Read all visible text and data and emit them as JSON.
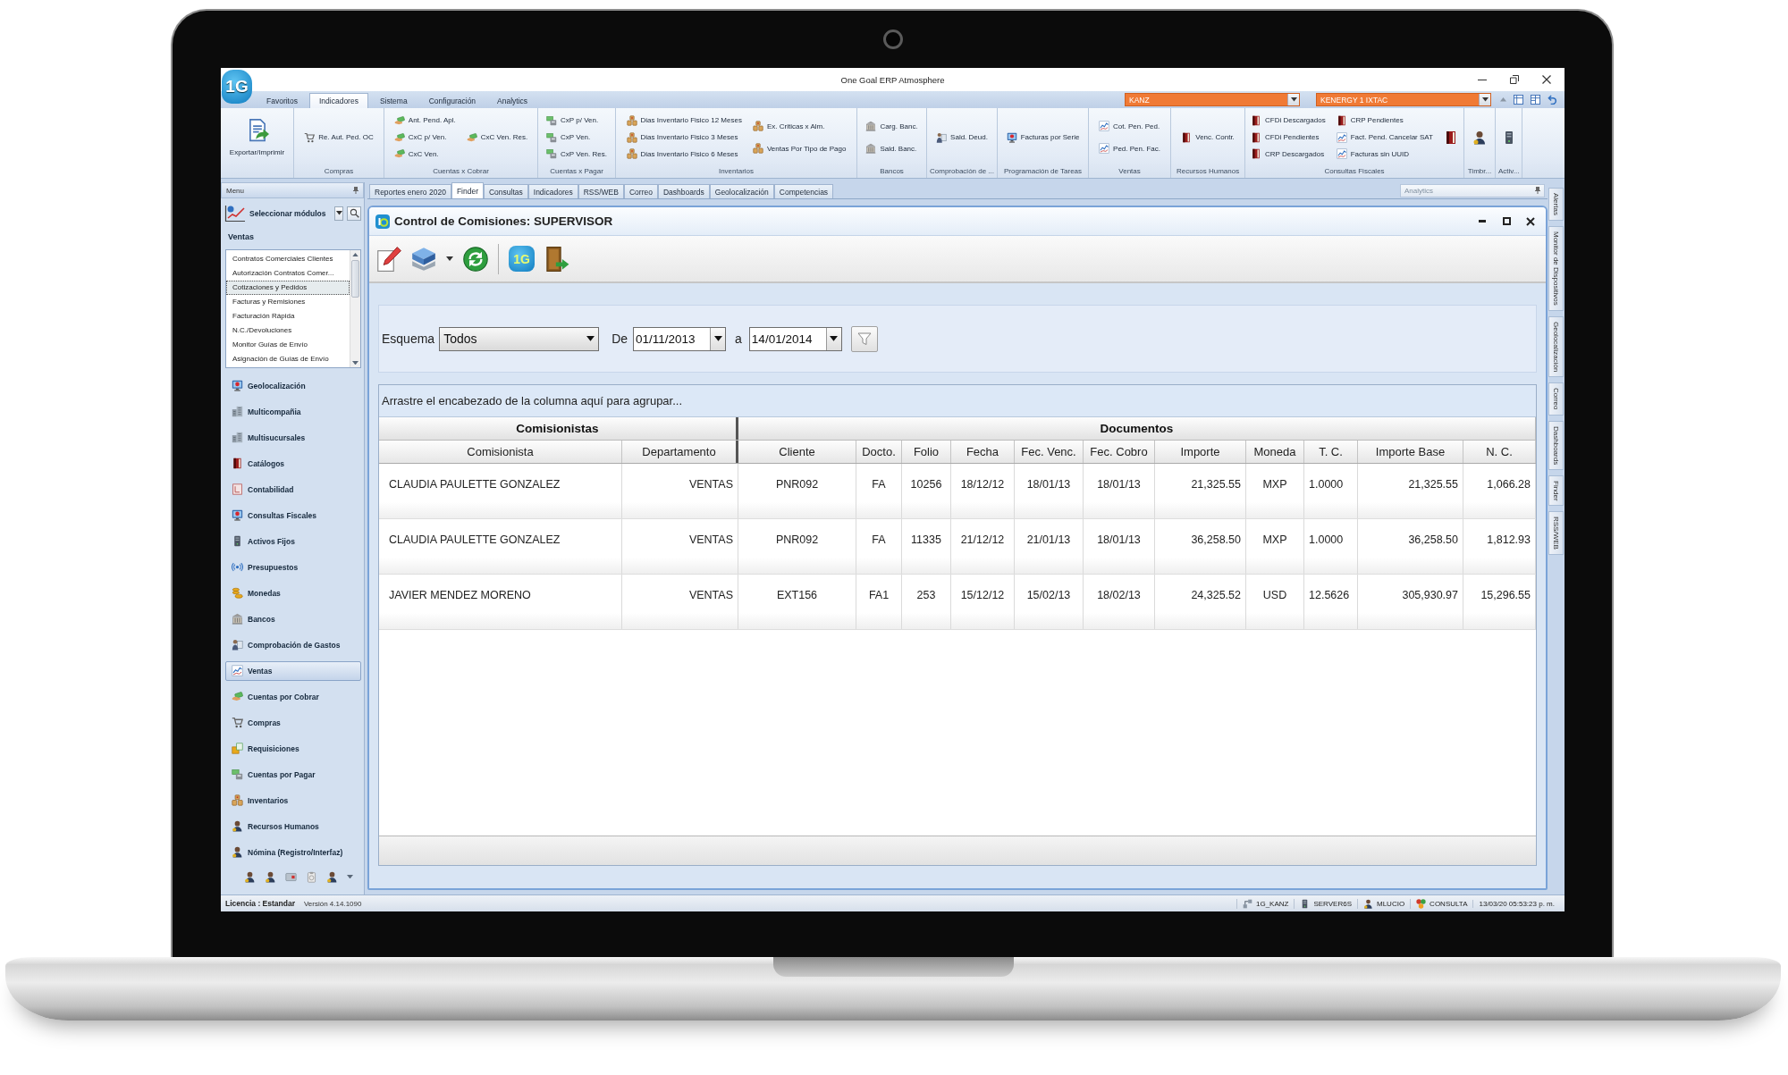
{
  "window": {
    "logo": "1G",
    "title": "One Goal ERP Atmosphere"
  },
  "ribbon": {
    "tabs": [
      {
        "label": "Favoritos",
        "selected": false
      },
      {
        "label": "Indicadores",
        "selected": true
      },
      {
        "label": "Sistema",
        "selected": false
      },
      {
        "label": "Configuración",
        "selected": false
      },
      {
        "label": "Analytics",
        "selected": false
      }
    ],
    "selectors": [
      {
        "value": "KANZ"
      },
      {
        "value": "KENERGY 1 IXTAC"
      }
    ],
    "groups": [
      {
        "columns": [
          [
            {
              "kind": "large",
              "label": "Exportar/Imprimir"
            }
          ]
        ]
      },
      {
        "label": "Compras",
        "columns": [
          [
            {
              "kind": "small",
              "label": "Re. Aut. Ped. OC"
            }
          ]
        ]
      },
      {
        "label": "Cuentas x Cobrar",
        "columns": [
          [
            {
              "kind": "small",
              "label": "Ant. Pend. Apl."
            },
            {
              "kind": "small",
              "label": "CxC p/ Ven."
            },
            {
              "kind": "small",
              "label": "CxC Ven."
            }
          ],
          [
            {
              "kind": "small",
              "label": "CxC Ven. Res."
            }
          ]
        ]
      },
      {
        "label": "Cuentas x Pagar",
        "columns": [
          [
            {
              "kind": "small",
              "label": "CxP p/ Ven."
            },
            {
              "kind": "small",
              "label": "CxP Ven."
            },
            {
              "kind": "small",
              "label": "CxP Ven. Res."
            }
          ]
        ]
      },
      {
        "label": "Inventarios",
        "columns": [
          [
            {
              "kind": "small",
              "label": "Dias Inventario Fisico 12 Meses"
            },
            {
              "kind": "small",
              "label": "Dias Inventario Fisico 3 Meses"
            },
            {
              "kind": "small",
              "label": "Dias Inventario Fisico 6 Meses"
            }
          ],
          [
            {
              "kind": "small",
              "label": "Ex. Criticas x Alm."
            },
            {
              "kind": "small",
              "label": "Ventas Por Tipo de Pago"
            }
          ]
        ]
      },
      {
        "label": "Bancos",
        "columns": [
          [
            {
              "kind": "small",
              "label": "Carg. Banc."
            },
            {
              "kind": "small",
              "label": "Sald. Banc."
            }
          ]
        ]
      },
      {
        "label": "Comprobación de ...",
        "columns": [
          [
            {
              "kind": "small",
              "label": "Sald. Deud."
            }
          ]
        ]
      },
      {
        "label": "Programación de Tareas",
        "columns": [
          [
            {
              "kind": "small",
              "label": "Facturas por Serie"
            }
          ]
        ]
      },
      {
        "label": "Ventas",
        "columns": [
          [
            {
              "kind": "small",
              "label": "Cot. Pen. Ped."
            },
            {
              "kind": "small",
              "label": "Ped. Pen. Fac."
            }
          ]
        ]
      },
      {
        "label": "Recursos Humanos",
        "columns": [
          [
            {
              "kind": "small",
              "label": "Venc. Contr."
            }
          ]
        ]
      },
      {
        "label": "Consultas Fiscales",
        "columns": [
          [
            {
              "kind": "small",
              "label": "CFDi Descargados"
            },
            {
              "kind": "small",
              "label": "CFDi Pendientes"
            },
            {
              "kind": "small",
              "label": "CRP Descargados"
            }
          ],
          [
            {
              "kind": "small",
              "label": "CRP Pendientes"
            },
            {
              "kind": "small",
              "label": "Fact. Pend. Cancelar SAT"
            },
            {
              "kind": "small",
              "label": "Facturas sin UUID"
            }
          ],
          [
            {
              "kind": "icon"
            }
          ]
        ]
      },
      {
        "label": "Timbr...",
        "columns": [
          [
            {
              "kind": "icon"
            }
          ]
        ]
      },
      {
        "label": "Activ...",
        "columns": [
          [
            {
              "kind": "icon"
            }
          ]
        ]
      }
    ]
  },
  "sidebar": {
    "header": "Menu",
    "module_selector": "Seleccionar módulos",
    "section": "Ventas",
    "list": [
      {
        "label": "Contratos Comerciales Clientes",
        "selected": false
      },
      {
        "label": "Autorización Contratos Comer...",
        "selected": false
      },
      {
        "label": "Cotizaciones y Pedidos",
        "selected": true
      },
      {
        "label": "Facturas y Remisiones",
        "selected": false
      },
      {
        "label": "Facturación Rápida",
        "selected": false
      },
      {
        "label": "N.C./Devoluciones",
        "selected": false
      },
      {
        "label": "Monitor Guías de Envío",
        "selected": false
      },
      {
        "label": "Asignación de Guías de Envío",
        "selected": false
      }
    ],
    "modules": [
      {
        "label": "Geolocalización",
        "selected": false
      },
      {
        "label": "Multicompañia",
        "selected": false
      },
      {
        "label": "Multisucursales",
        "selected": false
      },
      {
        "label": "Catálogos",
        "selected": false
      },
      {
        "label": "Contabilidad",
        "selected": false
      },
      {
        "label": "Consultas Fiscales",
        "selected": false
      },
      {
        "label": "Activos Fijos",
        "selected": false
      },
      {
        "label": "Presupuestos",
        "selected": false
      },
      {
        "label": "Monedas",
        "selected": false
      },
      {
        "label": "Bancos",
        "selected": false
      },
      {
        "label": "Comprobación de Gastos",
        "selected": false
      },
      {
        "label": "Ventas",
        "selected": true
      },
      {
        "label": "Cuentas por Cobrar",
        "selected": false
      },
      {
        "label": "Compras",
        "selected": false
      },
      {
        "label": "Requisiciones",
        "selected": false
      },
      {
        "label": "Cuentas por Pagar",
        "selected": false
      },
      {
        "label": "Inventarios",
        "selected": false
      },
      {
        "label": "Recursos Humanos",
        "selected": false
      },
      {
        "label": "Nómina (Registro/Interfaz)",
        "selected": false
      }
    ]
  },
  "documents": {
    "tabs": [
      {
        "label": "Reportes enero 2020",
        "selected": false
      },
      {
        "label": "Finder",
        "selected": true
      },
      {
        "label": "Consultas",
        "selected": false
      },
      {
        "label": "Indicadores",
        "selected": false
      },
      {
        "label": "RSS/WEB",
        "selected": false
      },
      {
        "label": "Correo",
        "selected": false
      },
      {
        "label": "Dashboards",
        "selected": false
      },
      {
        "label": "Geolocalización",
        "selected": false
      },
      {
        "label": "Competencias",
        "selected": false
      }
    ],
    "analytics_panel": {
      "title": "Analytics"
    }
  },
  "form": {
    "title": "Control de Comisiones: SUPERVISOR",
    "toolbar": {
      "logo": "1G"
    },
    "filters": {
      "scheme_label": "Esquema",
      "scheme": "Todos",
      "from_label": "De",
      "from": "01/11/2013",
      "to_label": "a",
      "to": "14/01/2014"
    },
    "grid": {
      "group_hint": "Arrastre el encabezado de la columna aquí para agrupar...",
      "bands": [
        {
          "label": "Comisionistas",
          "columns": [
            "Comisionista",
            "Departamento"
          ]
        },
        {
          "label": "Documentos",
          "columns": [
            "Cliente",
            "Docto.",
            "Folio",
            "Fecha",
            "Fec. Venc.",
            "Fec. Cobro",
            "Importe",
            "Moneda",
            "T. C.",
            "Importe Base",
            "N. C."
          ]
        }
      ],
      "rows": [
        [
          "CLAUDIA PAULETTE GONZALEZ",
          "VENTAS",
          "PNR092",
          "FA",
          "10256",
          "18/12/12",
          "18/01/13",
          "18/01/13",
          "21,325.55",
          "MXP",
          "1.0000",
          "21,325.55",
          "1,066.28"
        ],
        [
          "CLAUDIA PAULETTE GONZALEZ",
          "VENTAS",
          "PNR092",
          "FA",
          "11335",
          "21/12/12",
          "21/01/13",
          "18/01/13",
          "36,258.50",
          "MXP",
          "1.0000",
          "36,258.50",
          "1,812.93"
        ],
        [
          "JAVIER MENDEZ MORENO",
          "VENTAS",
          "EXT156",
          "FA1",
          "253",
          "15/12/12",
          "15/02/13",
          "18/02/13",
          "24,325.52",
          "USD",
          "12.5626",
          "305,930.97",
          "15,296.55"
        ]
      ]
    }
  },
  "side_tabs": [
    {
      "label": "Alertas",
      "selected": false
    },
    {
      "label": "Monitor de Dispositivos",
      "selected": false
    },
    {
      "label": "Geolocalización",
      "selected": false
    },
    {
      "label": "Correo",
      "selected": false
    },
    {
      "label": "Dashboards",
      "selected": false
    },
    {
      "label": "Finder",
      "selected": false
    },
    {
      "label": "RSS/WEB",
      "selected": false
    }
  ],
  "status_bar": {
    "license": "Licencia : Estandar",
    "version": "Versión 4.14.1090",
    "items": [
      "1G_KANZ",
      "SERVER6S",
      "MLUCIO",
      "CONSULTA",
      "13/03/20 05:53:23 p. m."
    ]
  }
}
